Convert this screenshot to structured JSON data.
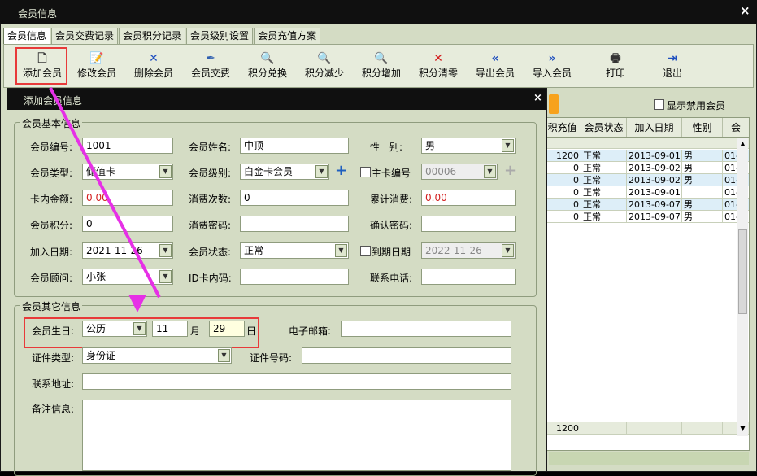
{
  "window": {
    "title": "会员信息",
    "close": "×"
  },
  "tabs": [
    "会员信息",
    "会员交费记录",
    "会员积分记录",
    "会员级别设置",
    "会员充值方案"
  ],
  "toolbar": [
    {
      "label": "添加会员",
      "icon": "document-icon",
      "glyph": "🗋",
      "color": "#3b3b3b"
    },
    {
      "label": "修改会员",
      "icon": "edit-document-icon",
      "glyph": "📝",
      "color": "#3b3b3b"
    },
    {
      "label": "删除会员",
      "icon": "delete-x-icon",
      "glyph": "✕",
      "color": "#1f4fbf"
    },
    {
      "label": "会员交费",
      "icon": "pen-icon",
      "glyph": "✒",
      "color": "#3060b0"
    },
    {
      "label": "积分兑换",
      "icon": "zoom-icon",
      "glyph": "🔍",
      "color": "#333"
    },
    {
      "label": "积分减少",
      "icon": "zoom-out-icon",
      "glyph": "🔍",
      "color": "#333"
    },
    {
      "label": "积分增加",
      "icon": "zoom-in-icon",
      "glyph": "🔍",
      "color": "#333"
    },
    {
      "label": "积分清零",
      "icon": "clear-x-icon",
      "glyph": "✕",
      "color": "#d42020"
    },
    {
      "label": "导出会员",
      "icon": "double-left-icon",
      "glyph": "«",
      "color": "#1f4fbf"
    },
    {
      "label": "导入会员",
      "icon": "double-right-icon",
      "glyph": "»",
      "color": "#1f4fbf"
    },
    {
      "label": "打印",
      "icon": "printer-icon",
      "glyph": "🖶",
      "color": "#333"
    },
    {
      "label": "退出",
      "icon": "exit-door-icon",
      "glyph": "⇥",
      "color": "#1f4fbf"
    }
  ],
  "show_disabled": "显示禁用会员",
  "grid": {
    "columns": [
      "积充值",
      "会员状态",
      "加入日期",
      "性别",
      "会"
    ],
    "rows": [
      [
        "1200",
        "正常",
        "2013-09-01",
        "男",
        "01-"
      ],
      [
        "0",
        "正常",
        "2013-09-02",
        "男",
        "01-"
      ],
      [
        "0",
        "正常",
        "2013-09-02",
        "男",
        "01-"
      ],
      [
        "0",
        "正常",
        "2013-09-01",
        "",
        "01-"
      ],
      [
        "0",
        "正常",
        "2013-09-07",
        "男",
        "01-"
      ],
      [
        "0",
        "正常",
        "2013-09-07",
        "男",
        "01-"
      ]
    ],
    "total": "1200"
  },
  "dialog": {
    "title": "添加会员信息",
    "close": "×",
    "basic": {
      "title": "会员基本信息",
      "member_no_label": "会员编号:",
      "member_no": "1001",
      "name_label": "会员姓名:",
      "name": "中顶",
      "gender_label": "性　别:",
      "gender": "男",
      "type_label": "会员类型:",
      "type": "储值卡",
      "level_label": "会员级别:",
      "level": "白金卡会员",
      "main_card_label": "主卡编号",
      "main_card": "00006",
      "balance_label": "卡内金额:",
      "balance": "0.00",
      "consume_count_label": "消费次数:",
      "consume_count": "0",
      "total_consume_label": "累计消费:",
      "total_consume": "0.00",
      "points_label": "会员积分:",
      "points": "0",
      "consume_pwd_label": "消费密码:",
      "confirm_pwd_label": "确认密码:",
      "join_date_label": "加入日期:",
      "join_date": "2021-11-26",
      "status_label": "会员状态:",
      "status": "正常",
      "expire_label": "到期日期",
      "expire_date": "2022-11-26",
      "advisor_label": "会员顾问:",
      "advisor": "小张",
      "id_card_label": "ID卡内码:",
      "phone_label": "联系电话:"
    },
    "other": {
      "title": "会员其它信息",
      "birthday_label": "会员生日:",
      "calendar": "公历",
      "month": "11",
      "month_unit": "月",
      "day": "29",
      "day_unit": "日",
      "email_label": "电子邮箱:",
      "id_type_label": "证件类型:",
      "id_type": "身份证",
      "id_no_label": "证件号码:",
      "address_label": "联系地址:",
      "remark_label": "备注信息:"
    }
  }
}
